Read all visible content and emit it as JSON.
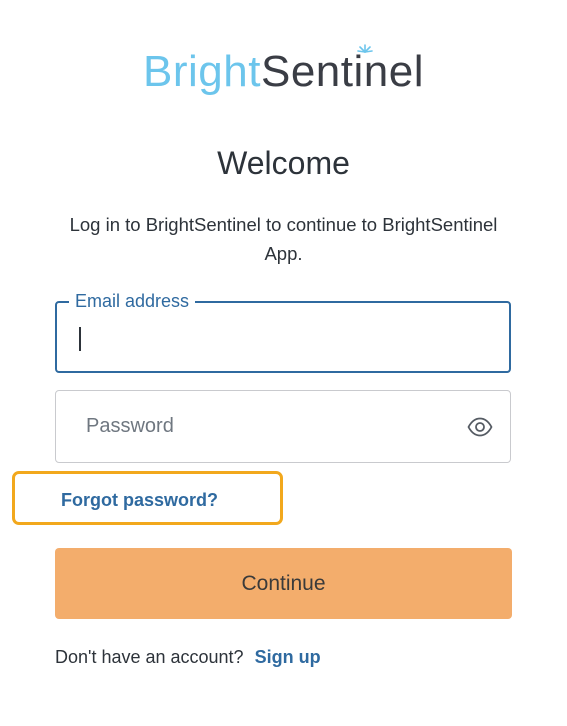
{
  "brand": {
    "part1": "Bright",
    "part2": "Sentinel",
    "colors": {
      "bright": "#6cc5ec",
      "sentinel": "#3a3d45"
    }
  },
  "heading": "Welcome",
  "subtitle": "Log in to BrightSentinel to continue to BrightSentinel App.",
  "email_field": {
    "label": "Email address",
    "value": ""
  },
  "password_field": {
    "placeholder": "Password",
    "toggle_icon": "eye-icon"
  },
  "forgot_password": "Forgot password?",
  "continue_button": "Continue",
  "signup": {
    "prompt": "Don't have an account?",
    "link": "Sign up"
  },
  "colors": {
    "accent": "#2f6aa0",
    "button": "#f3ad6c",
    "highlight": "#f2a81d"
  }
}
